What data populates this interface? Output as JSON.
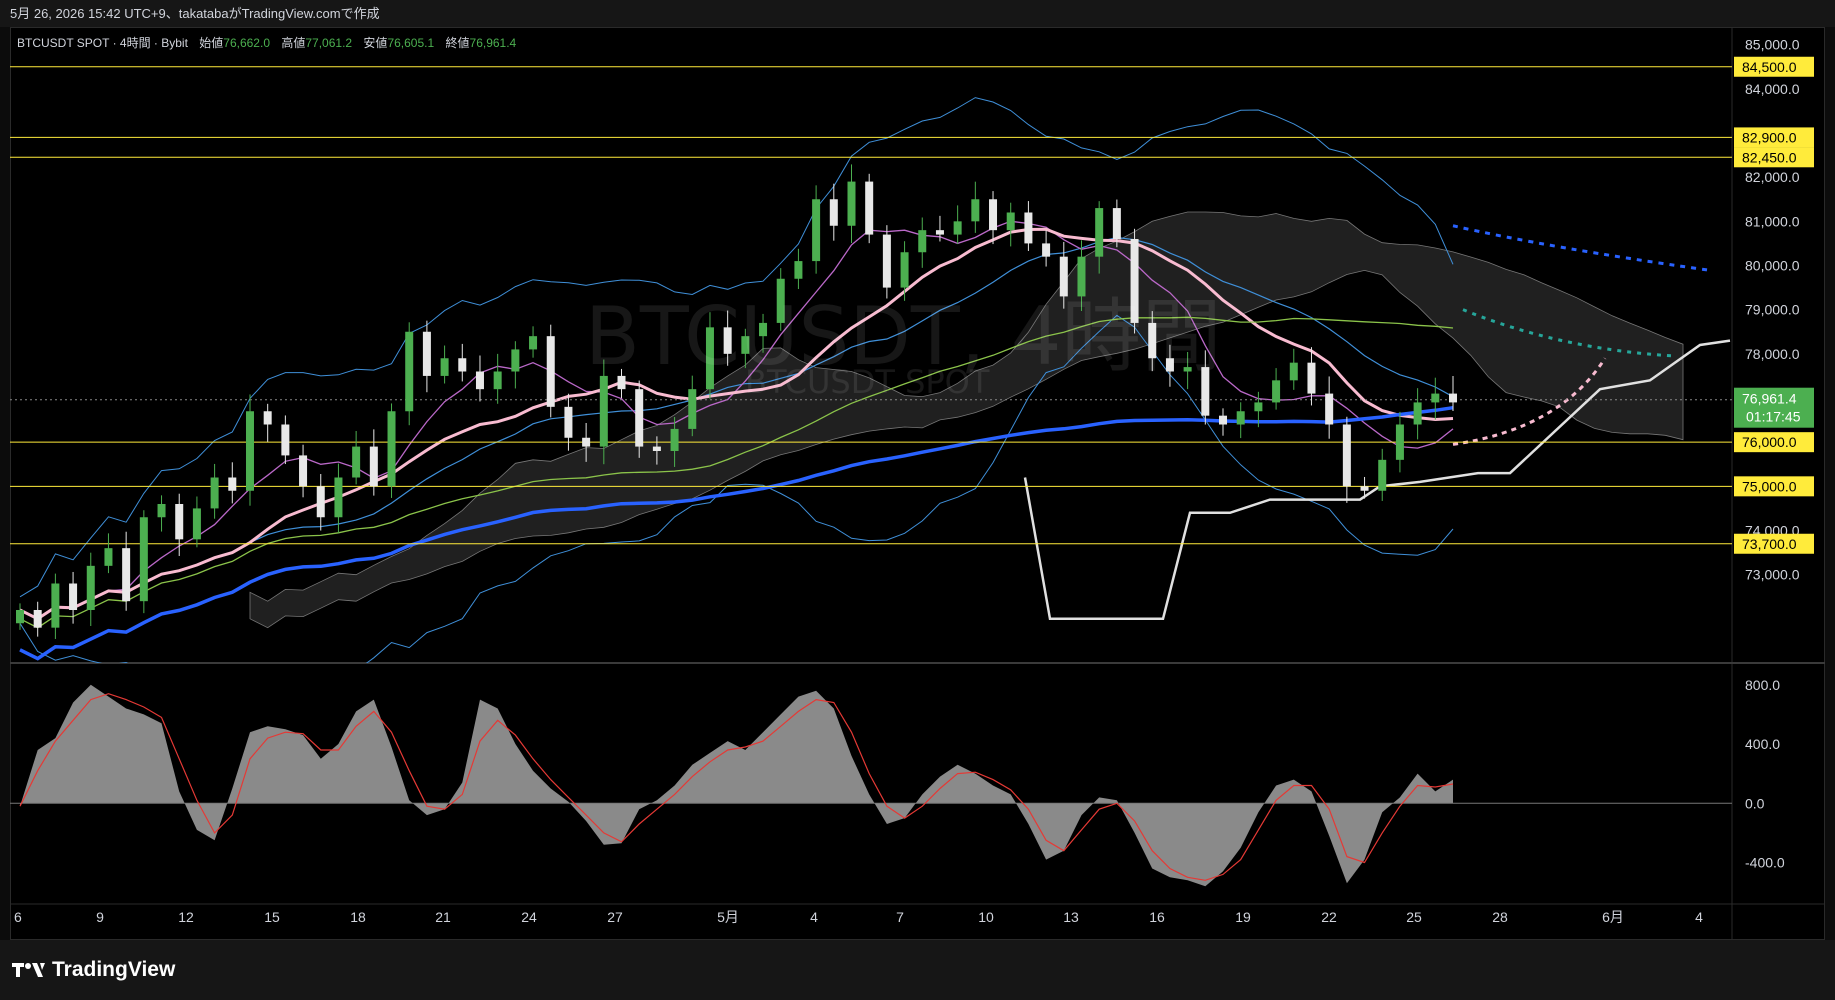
{
  "topbar": {
    "text": "5月 26, 2026 15:42 UTC+9、takatabaがTradingView.comで作成"
  },
  "legend": {
    "symbol": "BTCUSDT SPOT · 4時間 · Bybit",
    "open_label": "始値",
    "open": "76,662.0",
    "high_label": "高値",
    "high": "77,061.2",
    "low_label": "安値",
    "low": "76,605.1",
    "close_label": "終値",
    "close": "76,961.4"
  },
  "watermark": {
    "title": "BTCUSDT, 4時間",
    "subtitle": "BTCUSDT SPOT"
  },
  "footer": {
    "brand": "TradingView"
  },
  "colors": {
    "up": "#4caf50",
    "down": "#e8e8e8",
    "level_line": "#ffeb3b",
    "level_tag": "#ffeb3b",
    "price_tag": "#4caf50",
    "sma_blue": "#2962ff",
    "ma_pink": "#f8bbd0",
    "ma_green": "#8bc34a",
    "bb": "#3f8fd8",
    "cloud": "#3a3a3a",
    "white_line": "#e0e0e0",
    "osc_fill": "#8a8a8a",
    "osc_signal": "#e53935"
  },
  "chart_data": {
    "type": "candlestick",
    "symbol": "BTCUSDT SPOT",
    "timeframe": "4時間",
    "exchange": "Bybit",
    "ohlc_last": {
      "open": 76662.0,
      "high": 77061.2,
      "low": 76605.1,
      "close": 76961.4
    },
    "current_price": "76,961.4",
    "countdown": "01:17:45",
    "y_axis_ticks": [
      "85,000.0",
      "84,000.0",
      "82,000.0",
      "81,000.0",
      "80,000.0",
      "79,000.0",
      "78,000.0",
      "74,000.0",
      "73,000.0"
    ],
    "ylim": [
      71000,
      85400
    ],
    "horizontal_levels": [
      {
        "value": 84500,
        "label": "84,500.0"
      },
      {
        "value": 82900,
        "label": "82,900.0"
      },
      {
        "value": 82450,
        "label": "82,450.0"
      },
      {
        "value": 76000,
        "label": "76,000.0"
      },
      {
        "value": 75000,
        "label": "75,000.0"
      },
      {
        "value": 73700,
        "label": "73,700.0"
      }
    ],
    "x_axis_labels": [
      "6",
      "9",
      "12",
      "15",
      "18",
      "21",
      "24",
      "27",
      "5月",
      "4",
      "7",
      "10",
      "13",
      "16",
      "19",
      "22",
      "25",
      "28",
      "6月",
      "4"
    ],
    "closes": [
      72200,
      71800,
      72800,
      72200,
      73200,
      73600,
      72400,
      74300,
      74600,
      73800,
      74500,
      75200,
      74900,
      76700,
      76400,
      75700,
      75000,
      74300,
      75200,
      75900,
      75000,
      76700,
      78500,
      77500,
      77900,
      77600,
      77200,
      77600,
      78100,
      78400,
      76800,
      76100,
      75900,
      77500,
      77200,
      75900,
      75800,
      76300,
      77200,
      78600,
      78000,
      78400,
      78700,
      79700,
      80100,
      81500,
      80900,
      81900,
      80700,
      79500,
      80300,
      80800,
      80700,
      81000,
      81500,
      80800,
      81200,
      80500,
      80200,
      79300,
      80200,
      81300,
      80600,
      78700,
      77900,
      77600,
      77700,
      76600,
      76400,
      76700,
      76900,
      77400,
      77800,
      77100,
      76400,
      75000,
      74900,
      75600,
      76400,
      76900,
      77100,
      76900
    ],
    "ichimoku_tenkan_future": [],
    "oscillator": {
      "ticks": [
        "800.0",
        "400.0",
        "0.0",
        "-400.0"
      ],
      "ylim": [
        -680,
        920
      ],
      "histogram": [
        -20,
        360,
        440,
        680,
        800,
        720,
        640,
        600,
        540,
        80,
        -180,
        -250,
        100,
        480,
        520,
        500,
        460,
        300,
        400,
        620,
        700,
        380,
        20,
        -80,
        -40,
        140,
        700,
        640,
        400,
        220,
        100,
        10,
        -120,
        -280,
        -270,
        -40,
        20,
        120,
        260,
        340,
        420,
        360,
        480,
        600,
        720,
        760,
        640,
        320,
        60,
        -140,
        -100,
        60,
        180,
        260,
        200,
        120,
        60,
        -140,
        -380,
        -320,
        -80,
        40,
        20,
        -200,
        -440,
        -500,
        -520,
        -560,
        -460,
        -300,
        -60,
        120,
        160,
        80,
        -220,
        -540,
        -380,
        -60,
        40,
        200,
        80,
        160
      ],
      "signal": [
        -20,
        220,
        420,
        560,
        700,
        740,
        700,
        650,
        580,
        300,
        20,
        -200,
        -80,
        300,
        440,
        480,
        470,
        360,
        360,
        520,
        620,
        480,
        220,
        -20,
        -40,
        60,
        420,
        560,
        460,
        300,
        160,
        40,
        -80,
        -200,
        -260,
        -140,
        -40,
        60,
        180,
        280,
        360,
        380,
        420,
        520,
        620,
        700,
        680,
        480,
        200,
        -20,
        -100,
        -20,
        100,
        200,
        210,
        160,
        90,
        -40,
        -250,
        -320,
        -180,
        -40,
        0,
        -120,
        -320,
        -440,
        -500,
        -520,
        -480,
        -380,
        -180,
        20,
        120,
        120,
        -40,
        -360,
        -400,
        -200,
        -20,
        120,
        110,
        130
      ]
    }
  }
}
